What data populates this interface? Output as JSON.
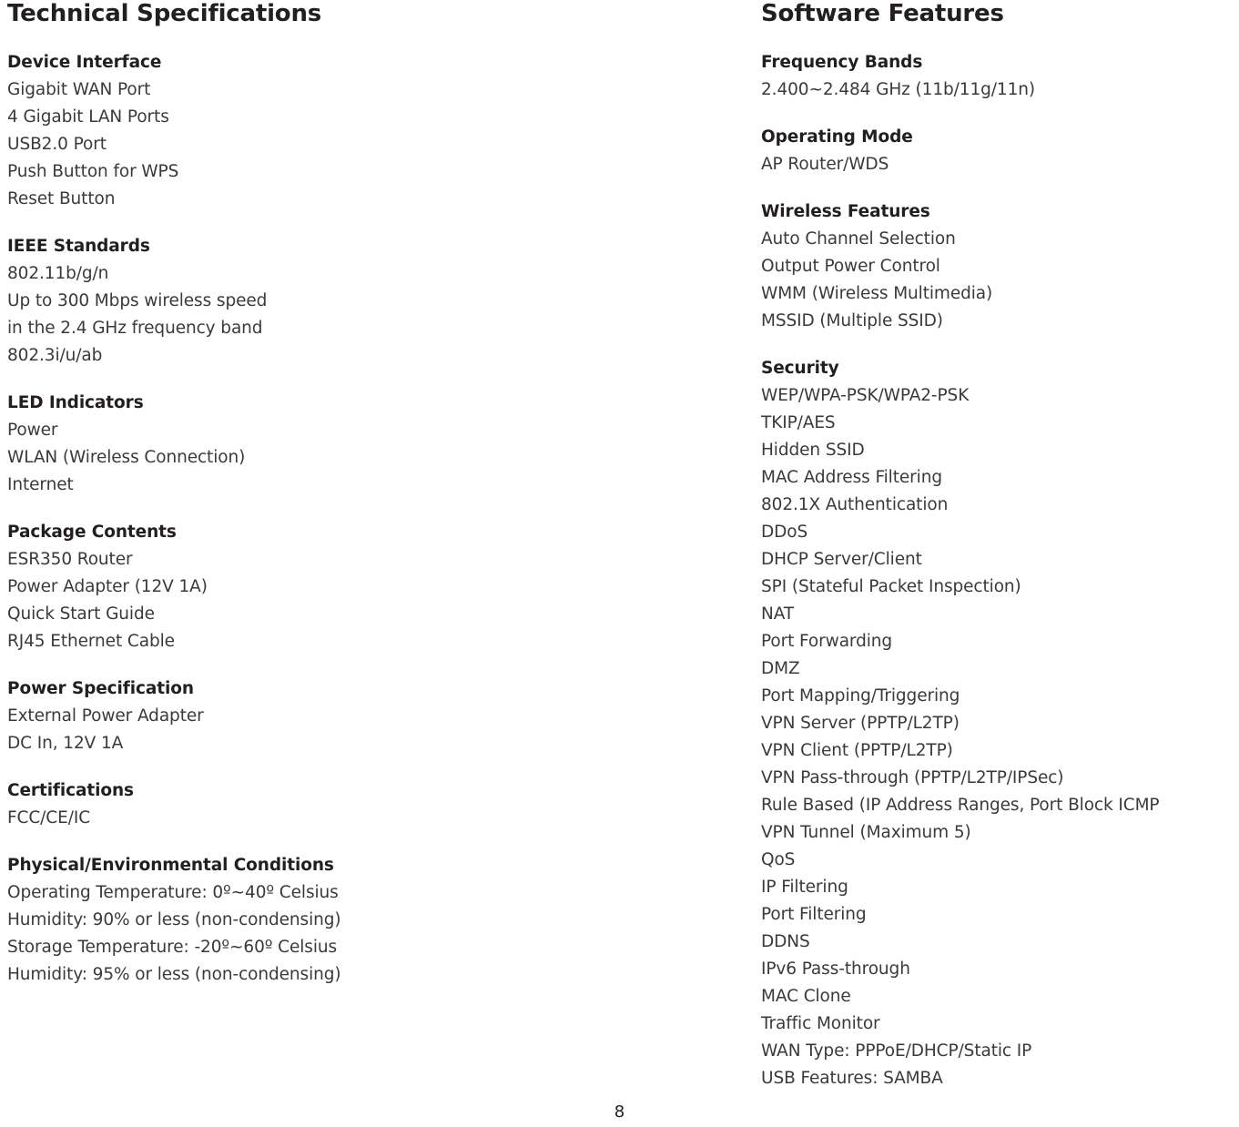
{
  "page": {
    "number": "8"
  },
  "left_column": {
    "title": "Technical Specifications",
    "groups": [
      {
        "heading": "Device Interface",
        "lines": [
          "Gigabit WAN Port",
          "4 Gigabit LAN Ports",
          "USB2.0 Port",
          "Push Button for WPS",
          "Reset Button"
        ]
      },
      {
        "heading": "IEEE Standards",
        "lines": [
          "802.11b/g/n",
          "Up to 300 Mbps wireless speed",
          "in the 2.4 GHz  frequency band",
          "802.3i/u/ab"
        ]
      },
      {
        "heading": "LED Indicators",
        "lines": [
          "Power",
          "WLAN (Wireless Connection)",
          "Internet"
        ]
      },
      {
        "heading": "Package Contents",
        "lines": [
          "ESR350 Router",
          "Power Adapter (12V 1A)",
          "Quick Start Guide",
          "RJ45 Ethernet Cable"
        ]
      },
      {
        "heading": "Power Specification",
        "lines": [
          "External Power Adapter",
          "DC In, 12V 1A"
        ]
      },
      {
        "heading": "Certifications",
        "lines": [
          "FCC/CE/IC"
        ]
      },
      {
        "heading": "Physical/Environmental Conditions",
        "lines": [
          "Operating Temperature: 0º~40º Celsius",
          "Humidity: 90% or less (non-condensing)",
          "Storage Temperature: -20º~60º Celsius",
          "Humidity: 95% or less (non-condensing)"
        ]
      }
    ]
  },
  "right_column": {
    "title": "Software Features",
    "groups": [
      {
        "heading": "Frequency Bands",
        "lines": [
          "2.400~2.484 GHz (11b/11g/11n)"
        ]
      },
      {
        "heading": "Operating Mode",
        "lines": [
          "AP Router/WDS"
        ]
      },
      {
        "heading": "Wireless Features",
        "lines": [
          "Auto Channel Selection",
          "Output Power Control",
          "WMM (Wireless Multimedia)",
          "MSSID (Multiple SSID)"
        ]
      },
      {
        "heading": "Security",
        "lines": [
          "WEP/WPA-PSK/WPA2-PSK",
          "TKIP/AES",
          "Hidden SSID",
          "MAC Address Filtering",
          "802.1X Authentication",
          "DDoS",
          "DHCP Server/Client",
          "SPI (Stateful Packet Inspection)",
          "NAT",
          "Port Forwarding",
          "DMZ",
          "Port Mapping/Triggering",
          "VPN Server (PPTP/L2TP)",
          "VPN Client (PPTP/L2TP)",
          "VPN Pass-through (PPTP/L2TP/IPSec)",
          "Rule Based (IP Address Ranges, Port Block ICMP",
          "VPN Tunnel (Maximum 5)",
          "QoS",
          "IP Filtering",
          "Port Filtering",
          "DDNS",
          "IPv6 Pass-through",
          "MAC Clone",
          "Traffic Monitor",
          "WAN Type: PPPoE/DHCP/Static IP",
          "USB Features: SAMBA"
        ]
      }
    ]
  }
}
